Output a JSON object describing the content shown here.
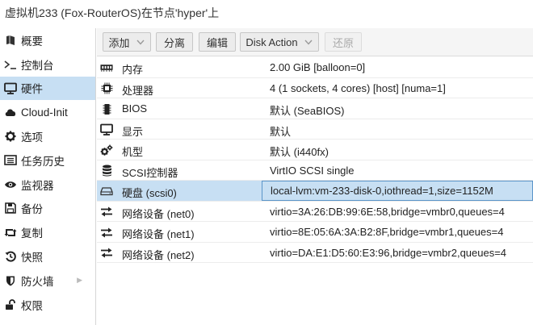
{
  "window": {
    "title": "虚拟机233 (Fox-RouterOS)在节点'hyper'上"
  },
  "sidebar": {
    "items": [
      {
        "label": "概要",
        "icon": "book-icon"
      },
      {
        "label": "控制台",
        "icon": "terminal-icon"
      },
      {
        "label": "硬件",
        "icon": "monitor-icon",
        "active": true
      },
      {
        "label": "Cloud-Init",
        "icon": "cloud-icon"
      },
      {
        "label": "选项",
        "icon": "gear-icon"
      },
      {
        "label": "任务历史",
        "icon": "list-icon"
      },
      {
        "label": "监视器",
        "icon": "eye-icon"
      },
      {
        "label": "备份",
        "icon": "floppy-icon"
      },
      {
        "label": "复制",
        "icon": "retweet-icon"
      },
      {
        "label": "快照",
        "icon": "history-icon"
      },
      {
        "label": "防火墙",
        "icon": "shield-icon"
      },
      {
        "label": "权限",
        "icon": "unlock-icon"
      }
    ]
  },
  "toolbar": {
    "add_label": "添加",
    "detach_label": "分离",
    "edit_label": "编辑",
    "disk_action_label": "Disk Action",
    "revert_label": "还原"
  },
  "hardware": {
    "rows": [
      {
        "name": "内存",
        "value": "2.00 GiB [balloon=0]",
        "icon": "memory-icon"
      },
      {
        "name": "处理器",
        "value": "4 (1 sockets, 4 cores) [host] [numa=1]",
        "icon": "cpu-icon"
      },
      {
        "name": "BIOS",
        "value": "默认 (SeaBIOS)",
        "icon": "microchip-icon"
      },
      {
        "name": "显示",
        "value": "默认",
        "icon": "desktop-icon"
      },
      {
        "name": "机型",
        "value": "默认 (i440fx)",
        "icon": "cogs-icon"
      },
      {
        "name": "SCSI控制器",
        "value": "VirtIO SCSI single",
        "icon": "database-icon"
      },
      {
        "name": "硬盘 (scsi0)",
        "value": "local-lvm:vm-233-disk-0,iothread=1,size=1152M",
        "icon": "hdd-icon",
        "selected": true
      },
      {
        "name": "网络设备 (net0)",
        "value": "virtio=3A:26:DB:99:6E:58,bridge=vmbr0,queues=4",
        "icon": "exchange-icon"
      },
      {
        "name": "网络设备 (net1)",
        "value": "virtio=8E:05:6A:3A:B2:8F,bridge=vmbr1,queues=4",
        "icon": "exchange-icon"
      },
      {
        "name": "网络设备 (net2)",
        "value": "virtio=DA:E1:D5:60:E3:96,bridge=vmbr2,queues=4",
        "icon": "exchange-icon"
      }
    ]
  }
}
